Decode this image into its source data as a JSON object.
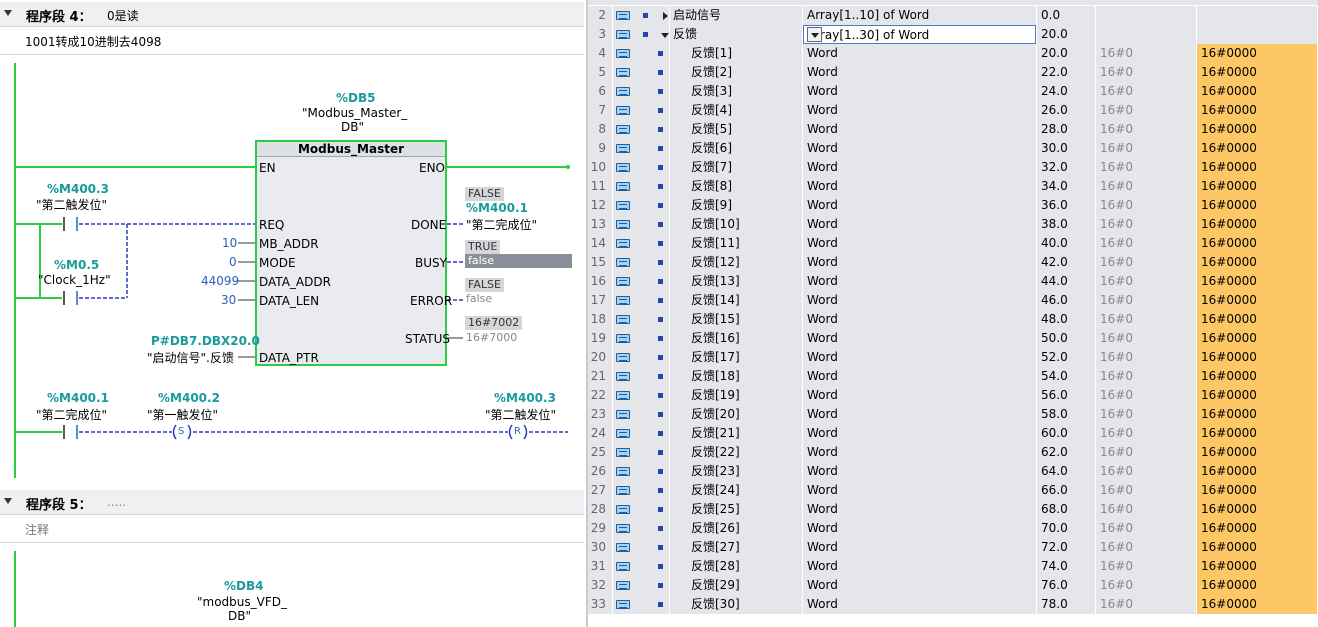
{
  "network4": {
    "title": "程序段 4：",
    "subtitle": "0是读",
    "comment": "1001转成10进制去4098",
    "db": {
      "address": "%DB5",
      "name_line1": "\"Modbus_Master_",
      "name_line2": "DB\""
    },
    "block": {
      "name": "Modbus_Master",
      "en": "EN",
      "eno": "ENO",
      "pins_in": [
        "REQ",
        "MB_ADDR",
        "MODE",
        "DATA_ADDR",
        "DATA_LEN",
        "DATA_PTR"
      ],
      "pins_out": [
        "DONE",
        "BUSY",
        "ERROR",
        "STATUS"
      ]
    },
    "contacts": {
      "c1_addr": "%M400.3",
      "c1_name": "\"第二触发位\"",
      "c2_addr": "%M0.5",
      "c2_name": "\"Clock_1Hz\""
    },
    "inputs": {
      "mb_addr": "10",
      "mode": "0",
      "data_addr": "44099",
      "data_len": "30",
      "data_ptr_addr": "P#DB7.DBX20.0",
      "data_ptr_name": "\"启动信号\".反馈"
    },
    "outputs": {
      "done_state": "FALSE",
      "done_addr": "%M400.1",
      "done_name": "\"第二完成位\"",
      "busy_state": "TRUE",
      "busy_value": "false",
      "error_state": "FALSE",
      "error_value": "false",
      "status_state": "16#7002",
      "status_value": "16#7000"
    },
    "rung2": {
      "c_addr": "%M400.1",
      "c_name": "\"第二完成位\"",
      "s_addr": "%M400.2",
      "s_name": "\"第一触发位\"",
      "s_coil": "S",
      "r_addr": "%M400.3",
      "r_name": "\"第二触发位\"",
      "r_coil": "R"
    }
  },
  "network5": {
    "title": "程序段 5：",
    "subtitle": ".....",
    "comment": "注释",
    "db": {
      "address": "%DB4",
      "name_line1": "\"modbus_VFD_",
      "name_line2": "DB\""
    }
  },
  "table": {
    "rows": [
      {
        "num": "2",
        "name": "启动信号",
        "type": "Array[1..10] of Word",
        "offset": "0.0",
        "start": "",
        "monitor": "",
        "expander": "right",
        "indent": 0
      },
      {
        "num": "3",
        "name": "反馈",
        "type": "Array[1..30] of Word",
        "offset": "20.0",
        "start": "",
        "monitor": "",
        "expander": "down",
        "indent": 0,
        "editing": true
      },
      {
        "num": "4",
        "name": "反馈[1]",
        "type": "Word",
        "offset": "20.0",
        "start": "16#0",
        "monitor": "16#0000"
      },
      {
        "num": "5",
        "name": "反馈[2]",
        "type": "Word",
        "offset": "22.0",
        "start": "16#0",
        "monitor": "16#0000"
      },
      {
        "num": "6",
        "name": "反馈[3]",
        "type": "Word",
        "offset": "24.0",
        "start": "16#0",
        "monitor": "16#0000"
      },
      {
        "num": "7",
        "name": "反馈[4]",
        "type": "Word",
        "offset": "26.0",
        "start": "16#0",
        "monitor": "16#0000"
      },
      {
        "num": "8",
        "name": "反馈[5]",
        "type": "Word",
        "offset": "28.0",
        "start": "16#0",
        "monitor": "16#0000"
      },
      {
        "num": "9",
        "name": "反馈[6]",
        "type": "Word",
        "offset": "30.0",
        "start": "16#0",
        "monitor": "16#0000"
      },
      {
        "num": "10",
        "name": "反馈[7]",
        "type": "Word",
        "offset": "32.0",
        "start": "16#0",
        "monitor": "16#0000"
      },
      {
        "num": "11",
        "name": "反馈[8]",
        "type": "Word",
        "offset": "34.0",
        "start": "16#0",
        "monitor": "16#0000"
      },
      {
        "num": "12",
        "name": "反馈[9]",
        "type": "Word",
        "offset": "36.0",
        "start": "16#0",
        "monitor": "16#0000"
      },
      {
        "num": "13",
        "name": "反馈[10]",
        "type": "Word",
        "offset": "38.0",
        "start": "16#0",
        "monitor": "16#0000"
      },
      {
        "num": "14",
        "name": "反馈[11]",
        "type": "Word",
        "offset": "40.0",
        "start": "16#0",
        "monitor": "16#0000"
      },
      {
        "num": "15",
        "name": "反馈[12]",
        "type": "Word",
        "offset": "42.0",
        "start": "16#0",
        "monitor": "16#0000"
      },
      {
        "num": "16",
        "name": "反馈[13]",
        "type": "Word",
        "offset": "44.0",
        "start": "16#0",
        "monitor": "16#0000"
      },
      {
        "num": "17",
        "name": "反馈[14]",
        "type": "Word",
        "offset": "46.0",
        "start": "16#0",
        "monitor": "16#0000"
      },
      {
        "num": "18",
        "name": "反馈[15]",
        "type": "Word",
        "offset": "48.0",
        "start": "16#0",
        "monitor": "16#0000"
      },
      {
        "num": "19",
        "name": "反馈[16]",
        "type": "Word",
        "offset": "50.0",
        "start": "16#0",
        "monitor": "16#0000"
      },
      {
        "num": "20",
        "name": "反馈[17]",
        "type": "Word",
        "offset": "52.0",
        "start": "16#0",
        "monitor": "16#0000"
      },
      {
        "num": "21",
        "name": "反馈[18]",
        "type": "Word",
        "offset": "54.0",
        "start": "16#0",
        "monitor": "16#0000"
      },
      {
        "num": "22",
        "name": "反馈[19]",
        "type": "Word",
        "offset": "56.0",
        "start": "16#0",
        "monitor": "16#0000"
      },
      {
        "num": "23",
        "name": "反馈[20]",
        "type": "Word",
        "offset": "58.0",
        "start": "16#0",
        "monitor": "16#0000"
      },
      {
        "num": "24",
        "name": "反馈[21]",
        "type": "Word",
        "offset": "60.0",
        "start": "16#0",
        "monitor": "16#0000"
      },
      {
        "num": "25",
        "name": "反馈[22]",
        "type": "Word",
        "offset": "62.0",
        "start": "16#0",
        "monitor": "16#0000"
      },
      {
        "num": "26",
        "name": "反馈[23]",
        "type": "Word",
        "offset": "64.0",
        "start": "16#0",
        "monitor": "16#0000"
      },
      {
        "num": "27",
        "name": "反馈[24]",
        "type": "Word",
        "offset": "66.0",
        "start": "16#0",
        "monitor": "16#0000"
      },
      {
        "num": "28",
        "name": "反馈[25]",
        "type": "Word",
        "offset": "68.0",
        "start": "16#0",
        "monitor": "16#0000"
      },
      {
        "num": "29",
        "name": "反馈[26]",
        "type": "Word",
        "offset": "70.0",
        "start": "16#0",
        "monitor": "16#0000"
      },
      {
        "num": "30",
        "name": "反馈[27]",
        "type": "Word",
        "offset": "72.0",
        "start": "16#0",
        "monitor": "16#0000"
      },
      {
        "num": "31",
        "name": "反馈[28]",
        "type": "Word",
        "offset": "74.0",
        "start": "16#0",
        "monitor": "16#0000"
      },
      {
        "num": "32",
        "name": "反馈[29]",
        "type": "Word",
        "offset": "76.0",
        "start": "16#0",
        "monitor": "16#0000"
      },
      {
        "num": "33",
        "name": "反馈[30]",
        "type": "Word",
        "offset": "78.0",
        "start": "16#0",
        "monitor": "16#0000"
      }
    ],
    "editor_icon": "list-icon",
    "monitor_color": "#fcc764"
  }
}
